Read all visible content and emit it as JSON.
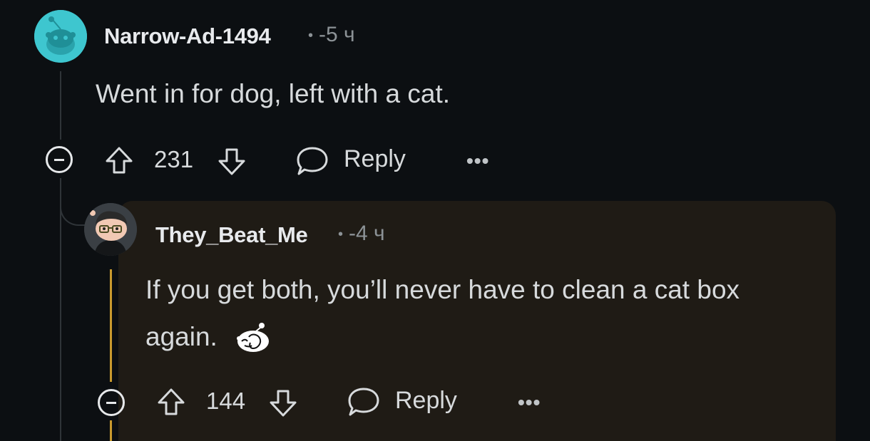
{
  "comments": [
    {
      "username": "Narrow-Ad-1494",
      "time": "-5 ч",
      "body": "Went in for dog, left with a cat.",
      "votes": "231",
      "reply_label": "Reply",
      "more_label": "•••",
      "avatar_color": "#3ec6cf"
    },
    {
      "username": "They_Beat_Me",
      "time": "-4 ч",
      "body_line1": "If you get both, you’ll never have to clean a cat box",
      "body_line2": "again.",
      "votes": "144",
      "reply_label": "Reply",
      "more_label": "•••",
      "highlight_color": "#1f1b15",
      "thread_color": "#c99a2e"
    }
  ],
  "separator": "•"
}
